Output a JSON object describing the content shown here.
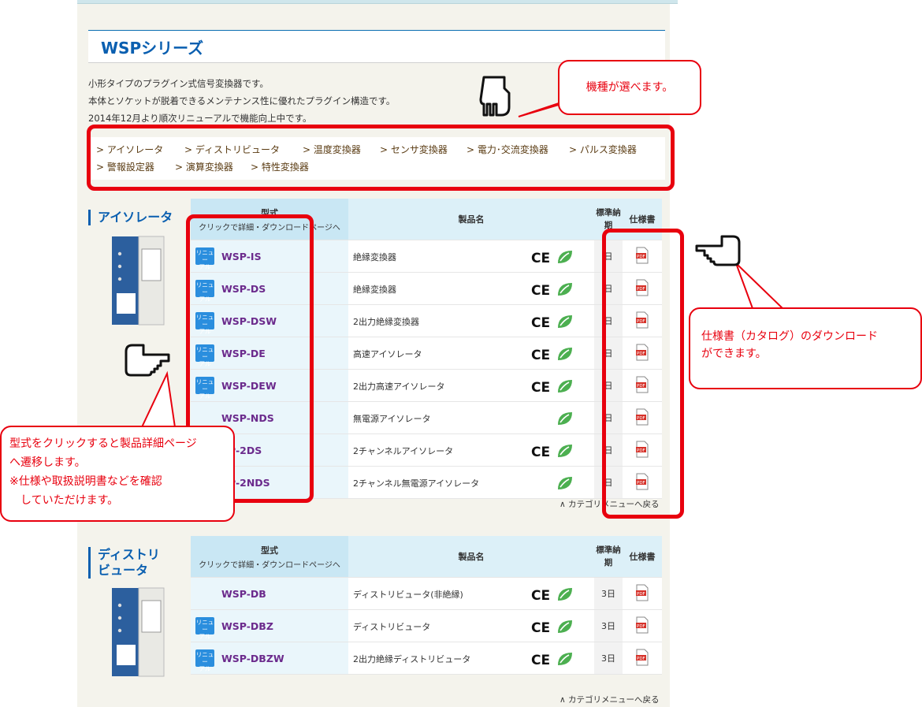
{
  "section": {
    "title": "WSPシリーズ",
    "intro": [
      "小形タイプのプラグイン式信号変換器です。",
      "本体とソケットが脱着できるメンテナンス性に優れたプラグイン構造です。",
      "2014年12月より順次リニューアルで機能向上中です。"
    ]
  },
  "category_menu": [
    "> アイソレータ",
    "> ディストリビュータ",
    "> 温度変換器",
    "> センサ変換器",
    "> 電力･交流変換器",
    "> パルス変換器",
    "> 警報設定器",
    "> 演算変換器",
    "> 特性変換器"
  ],
  "table_headers": {
    "model": "型式",
    "model_sub": "クリックで詳細・ダウンロードページへ",
    "name": "製品名",
    "days": "標準納期",
    "spec": "仕様書"
  },
  "badge_label": "リニューアル",
  "badge_lines": [
    "リニュー",
    "アル"
  ],
  "back_link": "∧ カテゴリメニューへ戻る",
  "groups": [
    {
      "title": "アイソレータ",
      "rows": [
        {
          "model": "WSP-IS",
          "name": "絶縁変換器",
          "days": "日",
          "renewal": true,
          "ce": true
        },
        {
          "model": "WSP-DS",
          "name": "絶縁変換器",
          "days": "日",
          "renewal": true,
          "ce": true
        },
        {
          "model": "WSP-DSW",
          "name": "2出力絶縁変換器",
          "days": "日",
          "renewal": true,
          "ce": true
        },
        {
          "model": "WSP-DE",
          "name": "高速アイソレータ",
          "days": "日",
          "renewal": true,
          "ce": true
        },
        {
          "model": "WSP-DEW",
          "name": "2出力高速アイソレータ",
          "days": "日",
          "renewal": true,
          "ce": true
        },
        {
          "model": "WSP-NDS",
          "name": "無電源アイソレータ",
          "days": "日",
          "renewal": false,
          "ce": false
        },
        {
          "model": "SP-2DS",
          "name": "2チャンネルアイソレータ",
          "days": "日",
          "renewal": false,
          "ce": true
        },
        {
          "model": "SP-2NDS",
          "name": "2チャンネル無電源アイソレータ",
          "days": "日",
          "renewal": false,
          "ce": false
        }
      ]
    },
    {
      "title_lines": [
        "ディストリ",
        "ビュータ"
      ],
      "rows": [
        {
          "model": "WSP-DB",
          "name": "ディストリビュータ(非絶縁)",
          "days": "3日",
          "renewal": false,
          "ce": true
        },
        {
          "model": "WSP-DBZ",
          "name": "ディストリビュータ",
          "days": "3日",
          "renewal": true,
          "ce": true
        },
        {
          "model": "WSP-DBZW",
          "name": "2出力絶縁ディストリビュータ",
          "days": "3日",
          "renewal": true,
          "ce": true
        }
      ]
    }
  ],
  "callouts": {
    "model_select": "機種が選べます。",
    "spec_download": [
      "仕様書（カタログ）のダウンロード",
      "ができます。"
    ],
    "click_model": [
      "型式をクリックすると製品詳細ページ",
      "へ遷移します。",
      "※仕様や取扱説明書などを確認",
      "　していただけます。"
    ]
  },
  "pdf_label": "PDF",
  "colors": {
    "accent": "#0a5fb0",
    "annotation": "#e8000e",
    "model_link": "#6b2a8c",
    "header_bg": "#dcf0f8"
  }
}
